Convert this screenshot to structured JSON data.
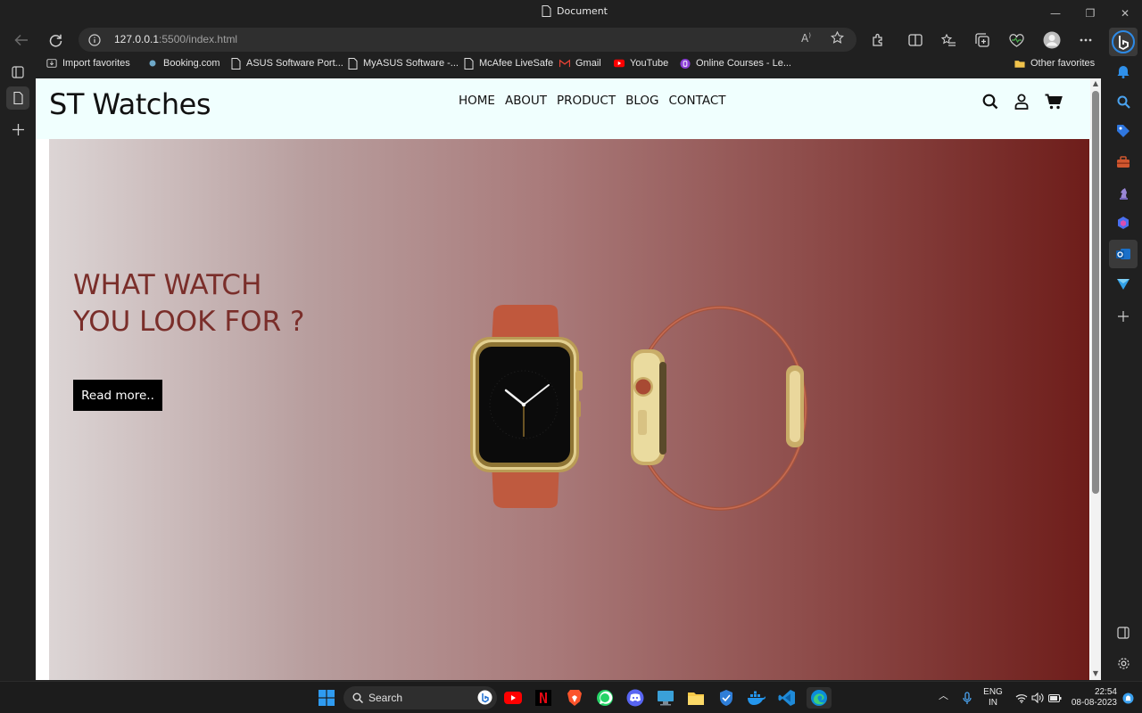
{
  "window": {
    "title": "Document",
    "minimize": "—",
    "maximize": "❐",
    "close": "✕"
  },
  "address": {
    "host": "127.0.0.1",
    "path": ":5500/index.html"
  },
  "favorites": [
    {
      "label": "Import favorites",
      "icon": "import-icon"
    },
    {
      "label": "Booking.com",
      "icon": "booking-icon"
    },
    {
      "label": "ASUS Software Port...",
      "icon": "page-icon"
    },
    {
      "label": "MyASUS Software -...",
      "icon": "page-icon"
    },
    {
      "label": "McAfee LiveSafe",
      "icon": "page-icon"
    },
    {
      "label": "Gmail",
      "icon": "gmail-icon"
    },
    {
      "label": "YouTube",
      "icon": "youtube-icon"
    },
    {
      "label": "Online Courses - Le...",
      "icon": "courses-icon"
    },
    {
      "label": "Other favorites",
      "icon": "folder-icon"
    }
  ],
  "site": {
    "brand": "ST Watches",
    "menu": [
      "HOME",
      "ABOUT",
      "PRODUCT",
      "BLOG",
      "CONTACT"
    ],
    "hero_heading": "WHAT WATCH YOU LOOK FOR ?",
    "hero_button": "Read more.."
  },
  "taskbar": {
    "search_label": "Search",
    "lang_top": "ENG",
    "lang_bottom": "IN",
    "time": "22:54",
    "date": "08-08-2023"
  },
  "colors": {
    "hero_heading": "#7a2e2a",
    "header_bg": "#f0fffe",
    "hero_gradient_start": "#dcd5d5",
    "hero_gradient_end": "#6e1d1a"
  }
}
